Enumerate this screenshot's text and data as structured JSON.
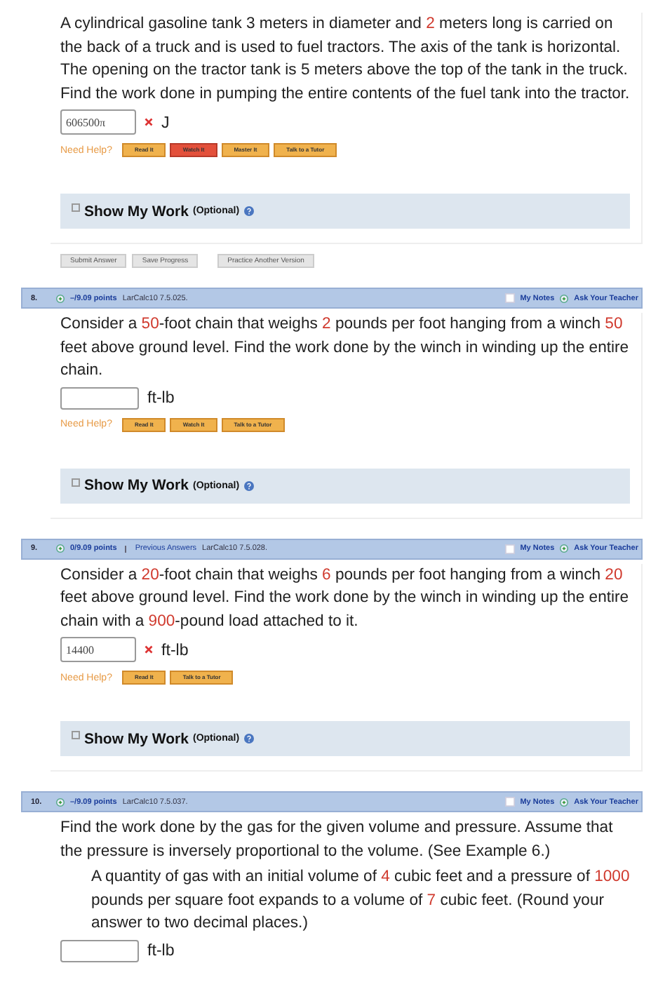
{
  "questions": [
    {
      "segments": [
        {
          "text": "A cylindrical gasoline tank ",
          "param": false
        },
        {
          "text": "3",
          "param": false
        },
        {
          "text": " meters in diameter and ",
          "param": false
        },
        {
          "text": "2",
          "param": true
        },
        {
          "text": " meters long is carried on the back of a truck and is used to fuel tractors. The axis of the tank is horizontal. The opening on the tractor tank is 5 meters above the top of the tank in the truck. Find the work done in pumping the entire contents of the fuel tank into the tractor.",
          "param": false
        }
      ],
      "answer": {
        "value": "606500π",
        "wrong": true,
        "unit": "J"
      },
      "help_label": "Need Help?",
      "help": [
        {
          "label": "Read It",
          "highlighted": false
        },
        {
          "label": "Watch It",
          "highlighted": true
        },
        {
          "label": "Master It",
          "highlighted": false
        },
        {
          "label": "Talk to a Tutor",
          "highlighted": false
        }
      ],
      "show_work": {
        "title": "Show My Work",
        "note": "(Optional)"
      },
      "actions": [
        "Submit Answer",
        "Save Progress",
        "Practice Another Version"
      ]
    },
    {
      "header": {
        "number": "8.",
        "points": "–/9.09 points",
        "reference": "LarCalc10 7.5.025.",
        "notes_checked": false,
        "notes": "My Notes",
        "ask": "Ask Your Teacher"
      },
      "segments": [
        {
          "text": "Consider a ",
          "param": false
        },
        {
          "text": "50",
          "param": true
        },
        {
          "text": "-foot chain that weighs ",
          "param": false
        },
        {
          "text": "2",
          "param": true
        },
        {
          "text": " pounds per foot hanging from a winch ",
          "param": false
        },
        {
          "text": "50",
          "param": true
        },
        {
          "text": " feet above ground level. Find the work done by the winch in winding up the entire chain.",
          "param": false
        }
      ],
      "answer": {
        "wrong": false,
        "unit": "ft-lb"
      },
      "help_label": "Need Help?",
      "help": [
        {
          "label": "Read It",
          "highlighted": false
        },
        {
          "label": "Watch It",
          "highlighted": false
        },
        {
          "label": "Talk to a Tutor",
          "highlighted": false
        }
      ],
      "show_work": {
        "title": "Show My Work",
        "note": "(Optional)"
      }
    },
    {
      "header": {
        "number": "9.",
        "points": "0/9.09 points",
        "previous": "Previous Answers",
        "reference": "LarCalc10 7.5.028.",
        "notes_checked": false,
        "notes": "My Notes",
        "ask": "Ask Your Teacher"
      },
      "segments": [
        {
          "text": "Consider a ",
          "param": false
        },
        {
          "text": "20",
          "param": true
        },
        {
          "text": "-foot chain that weighs ",
          "param": false
        },
        {
          "text": "6",
          "param": true
        },
        {
          "text": " pounds per foot hanging from a winch ",
          "param": false
        },
        {
          "text": "20",
          "param": true
        },
        {
          "text": " feet above ground level. Find the work done by the winch in winding up the entire chain with a ",
          "param": false
        },
        {
          "text": "900",
          "param": true
        },
        {
          "text": "-pound load attached to it.",
          "param": false
        }
      ],
      "answer": {
        "value": "14400",
        "wrong": true,
        "unit": "ft-lb"
      },
      "help_label": "Need Help?",
      "help": [
        {
          "label": "Read It",
          "highlighted": false
        },
        {
          "label": "Talk to a Tutor",
          "highlighted": false
        }
      ],
      "show_work": {
        "title": "Show My Work",
        "note": "(Optional)"
      }
    },
    {
      "header": {
        "number": "10.",
        "points": "–/9.09 points",
        "reference": "LarCalc10 7.5.037.",
        "notes_checked": false,
        "notes": "My Notes",
        "ask": "Ask Your Teacher"
      },
      "segments": [
        {
          "text": "Find the work done by the gas for the given volume and pressure. Assume that the pressure is inversely proportional to the volume. (See Example 6.)",
          "param": false
        }
      ],
      "sub_segments": [
        {
          "text": "A quantity of gas with an initial volume of ",
          "param": false
        },
        {
          "text": "4",
          "param": true
        },
        {
          "text": " cubic feet and a pressure of ",
          "param": false
        },
        {
          "text": "1000",
          "param": true
        },
        {
          "text": " pounds per square foot expands to a volume of ",
          "param": false
        },
        {
          "text": "7",
          "param": true
        },
        {
          "text": " cubic feet. (Round your answer to two decimal places.)",
          "param": false
        }
      ],
      "answer": {
        "wrong": false,
        "unit": "ft-lb"
      }
    }
  ]
}
